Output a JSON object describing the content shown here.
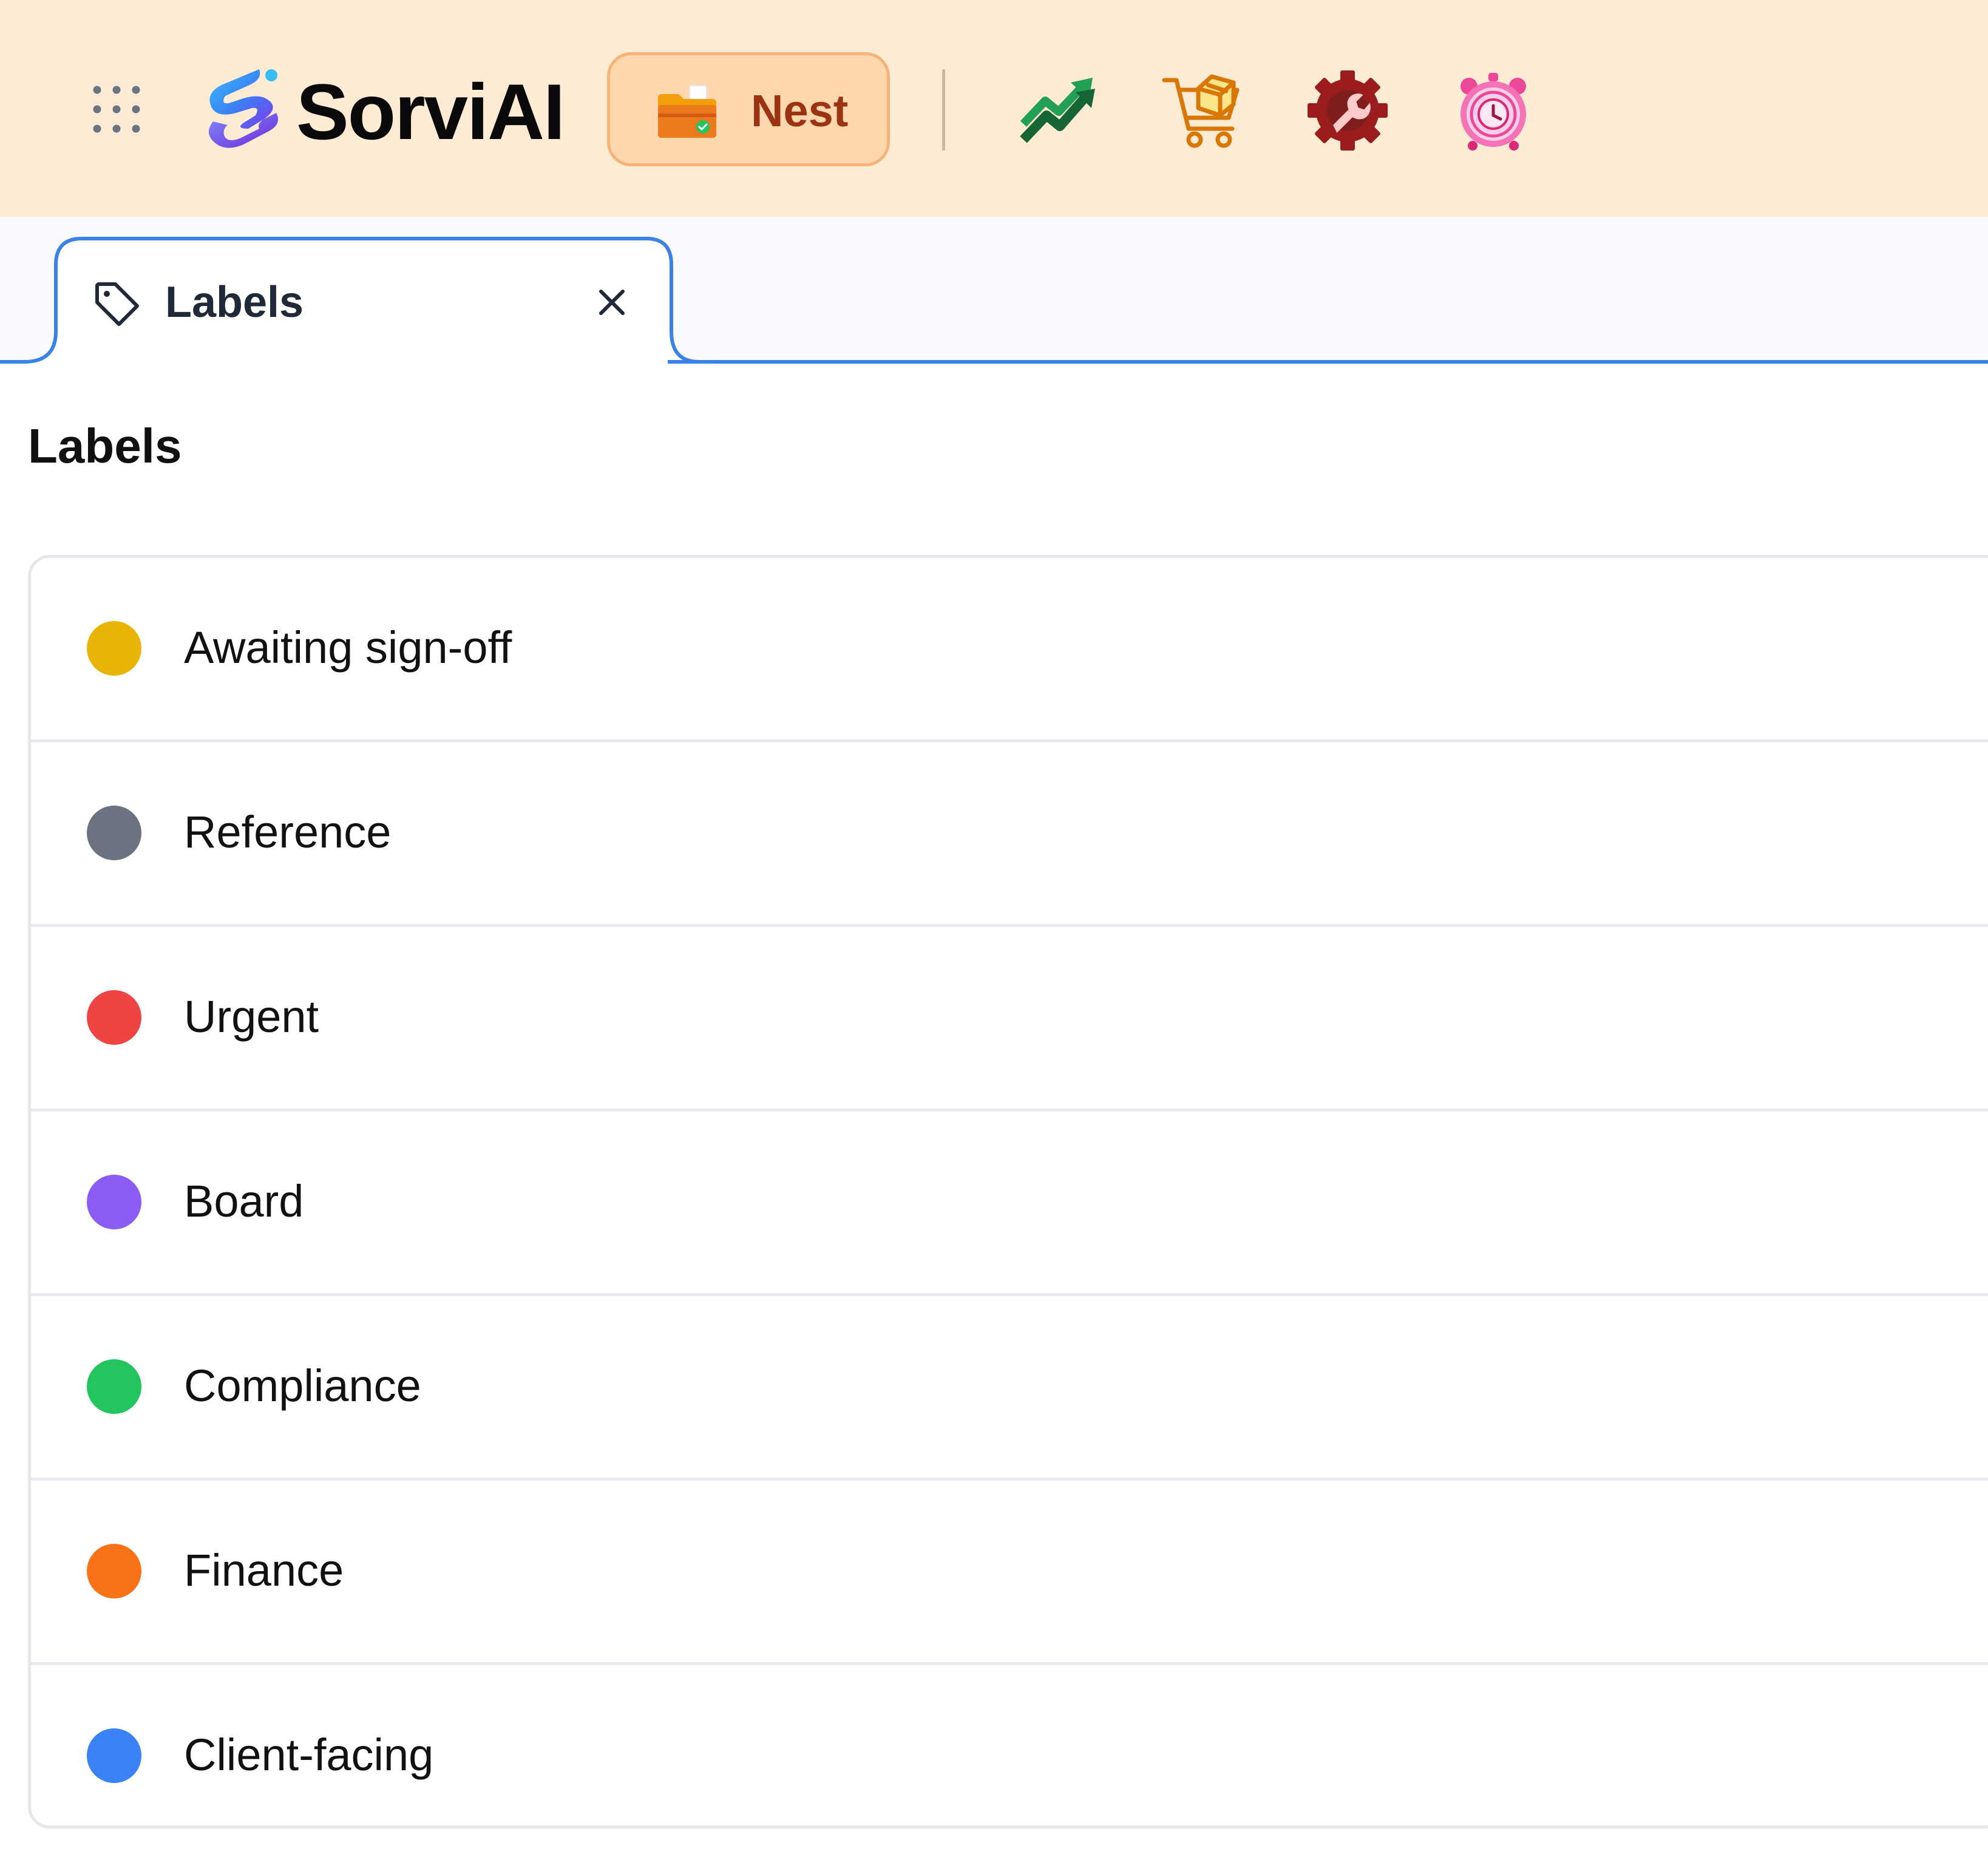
{
  "header": {
    "app_launcher_icon": "grid-dots-icon",
    "brand": {
      "logo_icon": "sorviai-s-logo-icon",
      "name": "SorviAI"
    },
    "active_app": {
      "icon": "folder-check-icon",
      "label": "Nest",
      "bg_color": "#fed7ae",
      "text_color": "#9a3412"
    },
    "apps": [
      {
        "icon": "trending-up-arrows-icon"
      },
      {
        "icon": "shopping-cart-box-icon"
      },
      {
        "icon": "gear-wrench-icon"
      },
      {
        "icon": "alarm-clock-icon"
      }
    ],
    "bg_color": "#feebd3"
  },
  "tabs": [
    {
      "icon": "tag-icon",
      "label": "Labels",
      "close_icon": "close-icon",
      "active": true
    }
  ],
  "main": {
    "title": "Labels",
    "labels": [
      {
        "name": "Awaiting sign-off",
        "color": "#eab308"
      },
      {
        "name": "Reference",
        "color": "#6b7280"
      },
      {
        "name": "Urgent",
        "color": "#ef4444"
      },
      {
        "name": "Board",
        "color": "#8b5cf6"
      },
      {
        "name": "Compliance",
        "color": "#22c55e"
      },
      {
        "name": "Finance",
        "color": "#f97316"
      },
      {
        "name": "Client-facing",
        "color": "#3b82f6"
      }
    ]
  },
  "accent_color": "#3b82e6"
}
